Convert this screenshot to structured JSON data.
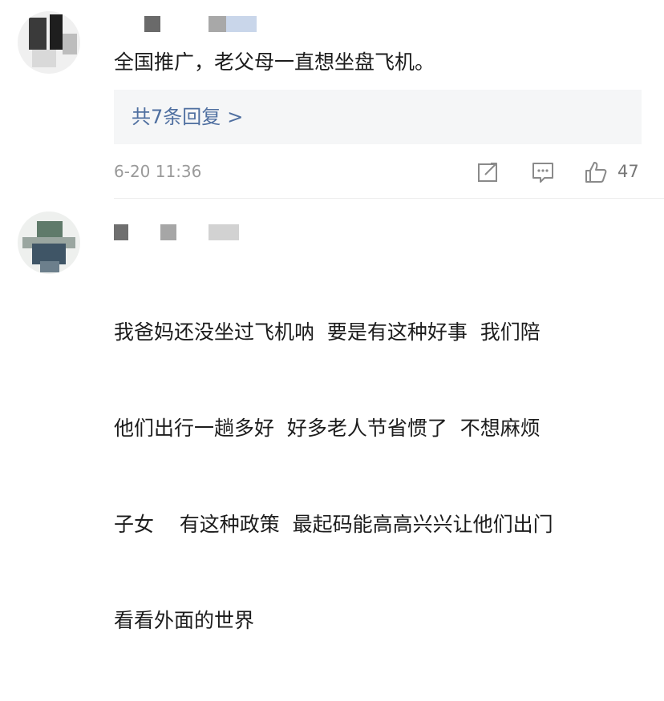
{
  "comments": [
    {
      "text": "全国推广，老父母一直想坐盘飞机。",
      "replies_label": "共7条回复",
      "replies_chevron": ">",
      "timestamp": "6-20 11:36",
      "like_count": "47"
    },
    {
      "text_lines": [
        "我爸妈还没坐过飞机呐  要是有这种好事  我们陪",
        "他们出行一趟多好  好多老人节省惯了  不想麻烦",
        "子女    有这种政策  最起码能高高兴兴让他们出门",
        "看看外面的世界"
      ]
    }
  ],
  "colors": {
    "reply_link": "#4f6fa0",
    "reply_bg": "#f5f6f7",
    "meta_gray": "#9a9a9a",
    "icon_gray": "#8a8a8a"
  },
  "icons": [
    "share-icon",
    "comment-icon",
    "like-icon"
  ]
}
